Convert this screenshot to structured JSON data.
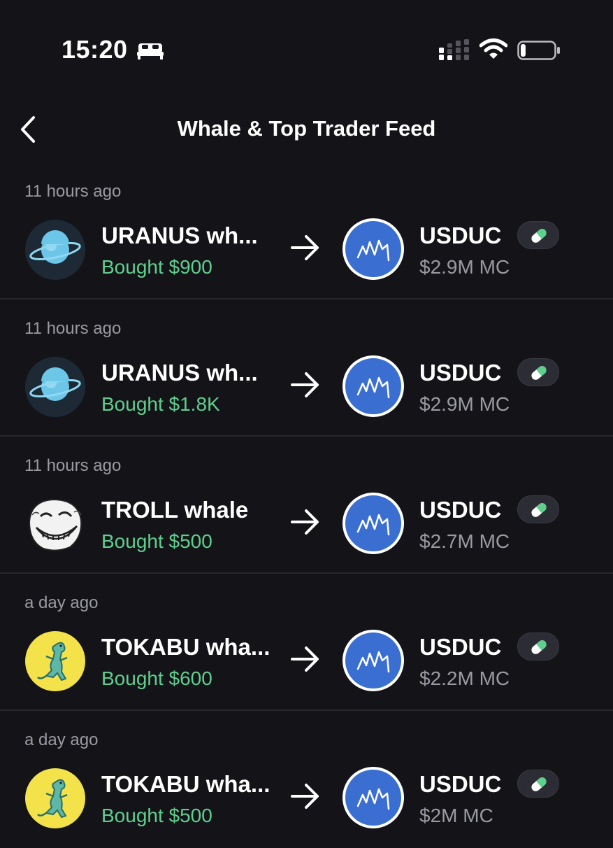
{
  "status_bar": {
    "time": "15:20",
    "focus_icon": "bed-icon",
    "signal_icon": "signal-icon",
    "wifi_icon": "wifi-icon",
    "battery_icon": "battery-icon",
    "battery_level": 0.15
  },
  "header": {
    "back_icon": "chevron-left-icon",
    "title": "Whale & Top Trader Feed"
  },
  "colors": {
    "background": "#141418",
    "positive": "#5fcf8e",
    "muted": "#9a9aa3",
    "token_blue": "#3a6fd1",
    "pill_accent": "#5fcf8e"
  },
  "feed": [
    {
      "time_ago": "11 hours ago",
      "trader_name": "URANUS wh...",
      "trader_avatar": "uranus-planet-avatar",
      "action": "Bought $900",
      "arrow_icon": "arrow-right-icon",
      "token_name": "USDUC",
      "token_avatar": "usduc-chart-avatar",
      "badge_icon": "pill-icon",
      "market_cap": "$2.9M MC"
    },
    {
      "time_ago": "11 hours ago",
      "trader_name": "URANUS wh...",
      "trader_avatar": "uranus-planet-avatar",
      "action": "Bought $1.8K",
      "arrow_icon": "arrow-right-icon",
      "token_name": "USDUC",
      "token_avatar": "usduc-chart-avatar",
      "badge_icon": "pill-icon",
      "market_cap": "$2.9M MC"
    },
    {
      "time_ago": "11 hours ago",
      "trader_name": "TROLL whale",
      "trader_avatar": "trollface-avatar",
      "action": "Bought $500",
      "arrow_icon": "arrow-right-icon",
      "token_name": "USDUC",
      "token_avatar": "usduc-chart-avatar",
      "badge_icon": "pill-icon",
      "market_cap": "$2.7M MC"
    },
    {
      "time_ago": "a day ago",
      "trader_name": "TOKABU wha...",
      "trader_avatar": "tokabu-lizard-avatar",
      "action": "Bought $600",
      "arrow_icon": "arrow-right-icon",
      "token_name": "USDUC",
      "token_avatar": "usduc-chart-avatar",
      "badge_icon": "pill-icon",
      "market_cap": "$2.2M MC"
    },
    {
      "time_ago": "a day ago",
      "trader_name": "TOKABU wha...",
      "trader_avatar": "tokabu-lizard-avatar",
      "action": "Bought $500",
      "arrow_icon": "arrow-right-icon",
      "token_name": "USDUC",
      "token_avatar": "usduc-chart-avatar",
      "badge_icon": "pill-icon",
      "market_cap": "$2M MC"
    }
  ]
}
